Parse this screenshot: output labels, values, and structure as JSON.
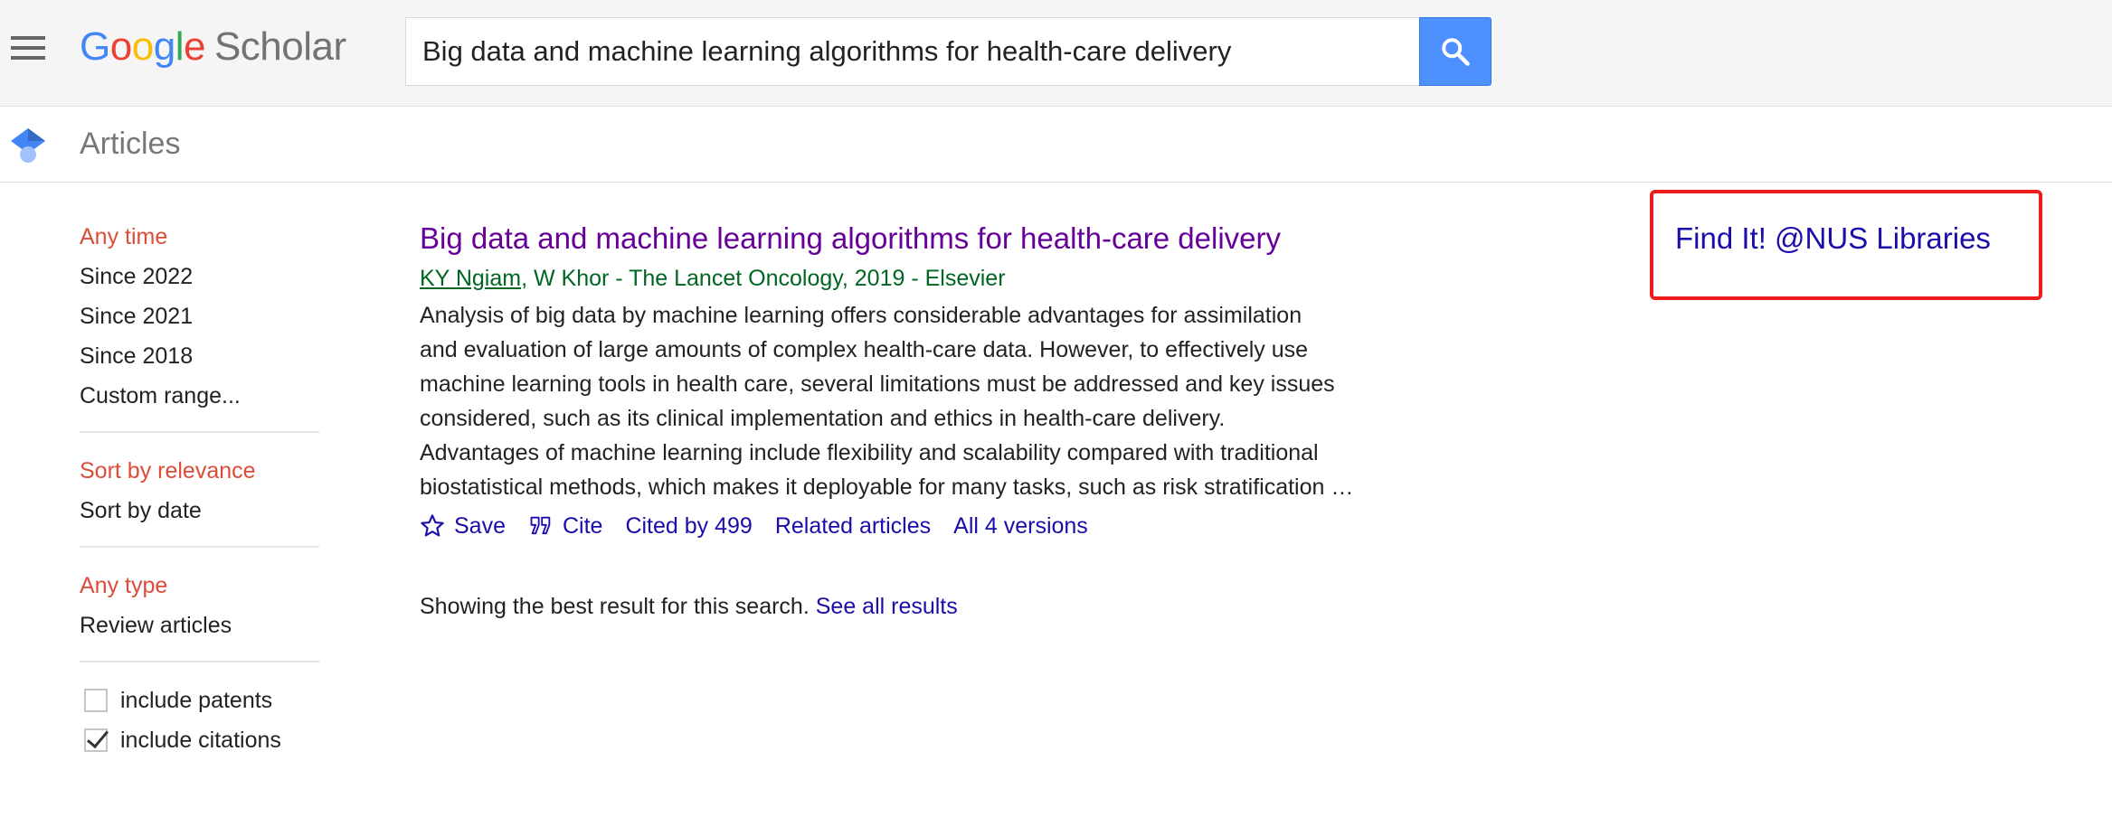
{
  "header": {
    "logo_google": [
      "G",
      "o",
      "o",
      "g",
      "l",
      "e"
    ],
    "logo_scholar": "Scholar",
    "search": {
      "value": "Big data and machine learning algorithms for health-care delivery",
      "placeholder": ""
    }
  },
  "subheader": {
    "title": "Articles"
  },
  "sidebar": {
    "time_filters": [
      {
        "label": "Any time",
        "selected": true
      },
      {
        "label": "Since 2022",
        "selected": false
      },
      {
        "label": "Since 2021",
        "selected": false
      },
      {
        "label": "Since 2018",
        "selected": false
      },
      {
        "label": "Custom range...",
        "selected": false
      }
    ],
    "sort_options": [
      {
        "label": "Sort by relevance",
        "selected": true
      },
      {
        "label": "Sort by date",
        "selected": false
      }
    ],
    "type_options": [
      {
        "label": "Any type",
        "selected": true
      },
      {
        "label": "Review articles",
        "selected": false
      }
    ],
    "checkboxes": [
      {
        "label": "include patents",
        "checked": false
      },
      {
        "label": "include citations",
        "checked": true
      }
    ]
  },
  "result": {
    "title": "Big data and machine learning algorithms for health-care delivery",
    "author_link": "KY Ngiam",
    "meta_rest": ", W Khor - The Lancet Oncology, 2019 - Elsevier",
    "snippet_lines": [
      "Analysis of big data by machine learning offers considerable advantages for assimilation",
      "and evaluation of large amounts of complex health-care data. However, to effectively use",
      "machine learning tools in health care, several limitations must be addressed and key issues",
      "considered, such as its clinical implementation and ethics in health-care delivery.",
      "Advantages of machine learning include flexibility and scalability compared with traditional",
      "biostatistical methods, which makes it deployable for many tasks, such as risk stratification …"
    ],
    "actions": {
      "save": "Save",
      "cite": "Cite",
      "cited_by": "Cited by 499",
      "related": "Related articles",
      "versions": "All 4 versions"
    }
  },
  "best_result": {
    "text": "Showing the best result for this search.",
    "link": "See all results"
  },
  "right_column": {
    "library_link": "Find It! @NUS Libraries"
  },
  "colors": {
    "selected_filter": "#dd4b39",
    "link": "#1a0dab",
    "visited_title": "#660099",
    "meta_green": "#006621",
    "search_button": "#4d90fe",
    "highlight_box": "#ee1c1c"
  }
}
